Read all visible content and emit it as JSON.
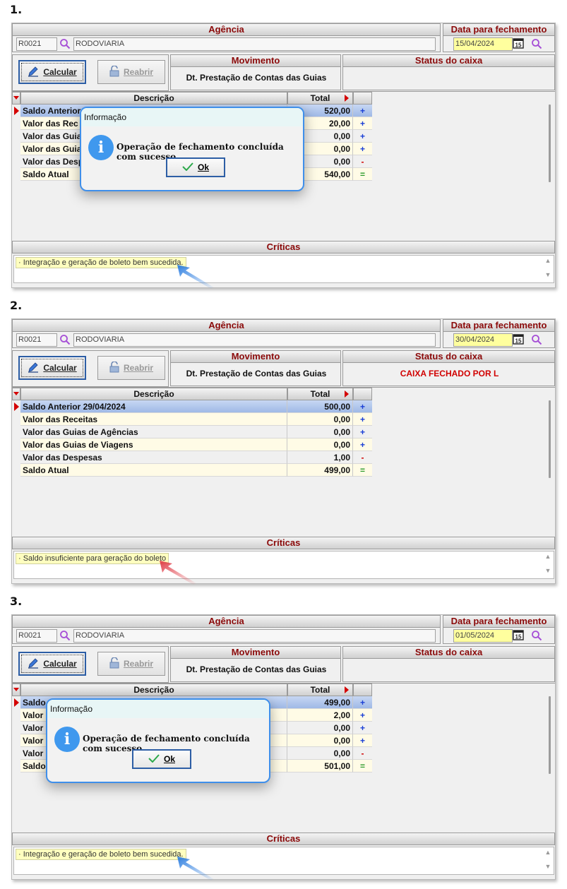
{
  "common": {
    "agencia_header": "Agência",
    "data_header": "Data para fechamento",
    "agency_code": "R0021",
    "agency_name": "RODOVIARIA",
    "calcular_label": "Calcular",
    "reabrir_label": "Reabrir",
    "movimento_header": "Movimento",
    "movimento_value": "Dt. Prestação de Contas das Guias",
    "status_header": "Status do caixa",
    "col_descricao": "Descrição",
    "col_total": "Total",
    "criticas_header": "Críticas",
    "calendar_day": "15",
    "dialog_title": "Informação",
    "dialog_message": "Operação de fechamento concluída com sucesso.",
    "dialog_ok": "Ok"
  },
  "screens": [
    {
      "number": "1.",
      "date": "15/04/2024",
      "status": "",
      "rows": [
        {
          "desc": "Saldo Anterior",
          "total": "520,00",
          "sign": "+"
        },
        {
          "desc": "Valor das Rec",
          "total": "20,00",
          "sign": "+"
        },
        {
          "desc": "Valor das Guias",
          "total": "0,00",
          "sign": "+"
        },
        {
          "desc": "Valor das Guia",
          "total": "0,00",
          "sign": "+"
        },
        {
          "desc": "Valor das Desp",
          "total": "0,00",
          "sign": "-"
        },
        {
          "desc": "Saldo Atual",
          "total": "540,00",
          "sign": "="
        }
      ],
      "critica": "· Integração e geração de boleto bem sucedida."
    },
    {
      "number": "2.",
      "date": "30/04/2024",
      "status": "CAIXA FECHADO POR L",
      "rows": [
        {
          "desc": "Saldo Anterior  29/04/2024",
          "total": "500,00",
          "sign": "+"
        },
        {
          "desc": "Valor das Receitas",
          "total": "0,00",
          "sign": "+"
        },
        {
          "desc": "Valor das Guias de Agências",
          "total": "0,00",
          "sign": "+"
        },
        {
          "desc": "Valor das Guias de Viagens",
          "total": "0,00",
          "sign": "+"
        },
        {
          "desc": "Valor das Despesas",
          "total": "1,00",
          "sign": "-"
        },
        {
          "desc": "Saldo Atual",
          "total": "499,00",
          "sign": "="
        }
      ],
      "critica": "· Saldo insuficiente para geração do boleto"
    },
    {
      "number": "3.",
      "date": "01/05/2024",
      "status": "",
      "rows": [
        {
          "desc": "Saldo",
          "total": "499,00",
          "sign": "+"
        },
        {
          "desc": "Valor",
          "total": "2,00",
          "sign": "+"
        },
        {
          "desc": "Valor",
          "total": "0,00",
          "sign": "+"
        },
        {
          "desc": "Valor",
          "total": "0,00",
          "sign": "+"
        },
        {
          "desc": "Valor",
          "total": "0,00",
          "sign": "-"
        },
        {
          "desc": "Saldo",
          "total": "501,00",
          "sign": "="
        }
      ],
      "critica": "· Integração e geração de boleto bem sucedida."
    }
  ],
  "colors": {
    "header_text": "#8b0a0a",
    "status_red": "#d10000",
    "dialog_border": "#3f8fea",
    "arrow_blue": "#2f7fe0",
    "arrow_red": "#e0404a"
  },
  "icons": [
    "search-icon",
    "calendar-icon",
    "pencil-icon",
    "unlock-icon",
    "row-pointer-icon",
    "info-icon",
    "check-icon",
    "annotation-arrow-icon"
  ]
}
